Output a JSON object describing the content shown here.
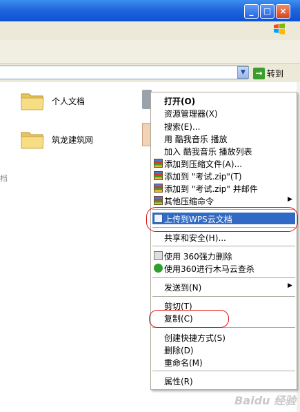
{
  "window": {
    "min_glyph": "_",
    "max_glyph": "□",
    "close_glyph": "×"
  },
  "address": {
    "value": "",
    "dropdown_glyph": "▼",
    "go_glyph": "→",
    "go_label": "转到"
  },
  "folders": [
    {
      "label": "个人文档"
    },
    {
      "label": "筑龙建筑网"
    }
  ],
  "edge_text": "档",
  "context_menu": {
    "items": [
      {
        "label": "打开(O)",
        "bold": true
      },
      {
        "label": "资源管理器(X)"
      },
      {
        "label": "搜索(E)..."
      },
      {
        "label": "用 酷我音乐 播放"
      },
      {
        "label": "加入 酷我音乐 播放列表"
      },
      {
        "label": "添加到压缩文件(A)...",
        "icon": "winrar-icon"
      },
      {
        "label": "添加到 \"考试.zip\"(T)",
        "icon": "winrar-icon"
      },
      {
        "label": "添加到 \"考试.zip\" 并邮件",
        "icon": "winrar-icon"
      },
      {
        "label": "其他压缩命令",
        "icon": "winrar-icon",
        "submenu": true
      },
      {
        "label": "上传到WPS云文档",
        "icon": "wps-cloud-icon",
        "highlighted": true
      },
      {
        "label": "共享和安全(H)..."
      },
      {
        "label": "使用 360强力删除",
        "icon": "shredder-icon"
      },
      {
        "label": "使用360进行木马云查杀",
        "icon": "360-safe-icon"
      },
      {
        "label": "发送到(N)",
        "submenu": true
      },
      {
        "label": "剪切(T)"
      },
      {
        "label": "复制(C)"
      },
      {
        "label": "创建快捷方式(S)"
      },
      {
        "label": "删除(D)"
      },
      {
        "label": "重命名(M)"
      },
      {
        "label": "属性(R)"
      }
    ],
    "submenu_glyph": "▶"
  },
  "watermark": "Baidu 经验",
  "colors": {
    "highlight": "#316ac5",
    "annotation": "#e01010",
    "titlebar": "#0b52d4"
  }
}
